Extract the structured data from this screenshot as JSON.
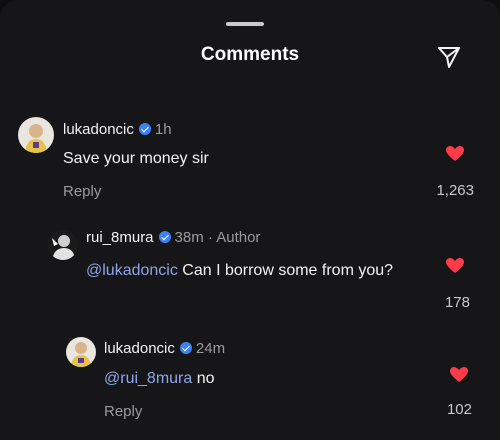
{
  "header": {
    "title": "Comments",
    "share_icon": "paper-plane-icon"
  },
  "comments": [
    {
      "username": "lukadoncic",
      "time": "1h",
      "author_tag": "",
      "mention": "",
      "text": "Save your money sir",
      "reply_label": "Reply",
      "likes": "1,263",
      "avatar_color": "#e7c34a"
    },
    {
      "username": "rui_8mura",
      "time": "38m",
      "author_tag": " · Author",
      "mention": "@lukadoncic",
      "text": " Can I borrow some from you?",
      "reply_label": "",
      "likes": "178",
      "avatar_color": "#d8d8d8"
    },
    {
      "username": "lukadoncic",
      "time": "24m",
      "author_tag": "",
      "mention": "@rui_8mura",
      "text": " no",
      "reply_label": "Reply",
      "likes": "102",
      "avatar_color": "#e7c34a"
    }
  ],
  "colors": {
    "background": "#161618",
    "heart": "#ff3b4a",
    "verified": "#3b82f6",
    "mention": "#8ea6e8"
  }
}
